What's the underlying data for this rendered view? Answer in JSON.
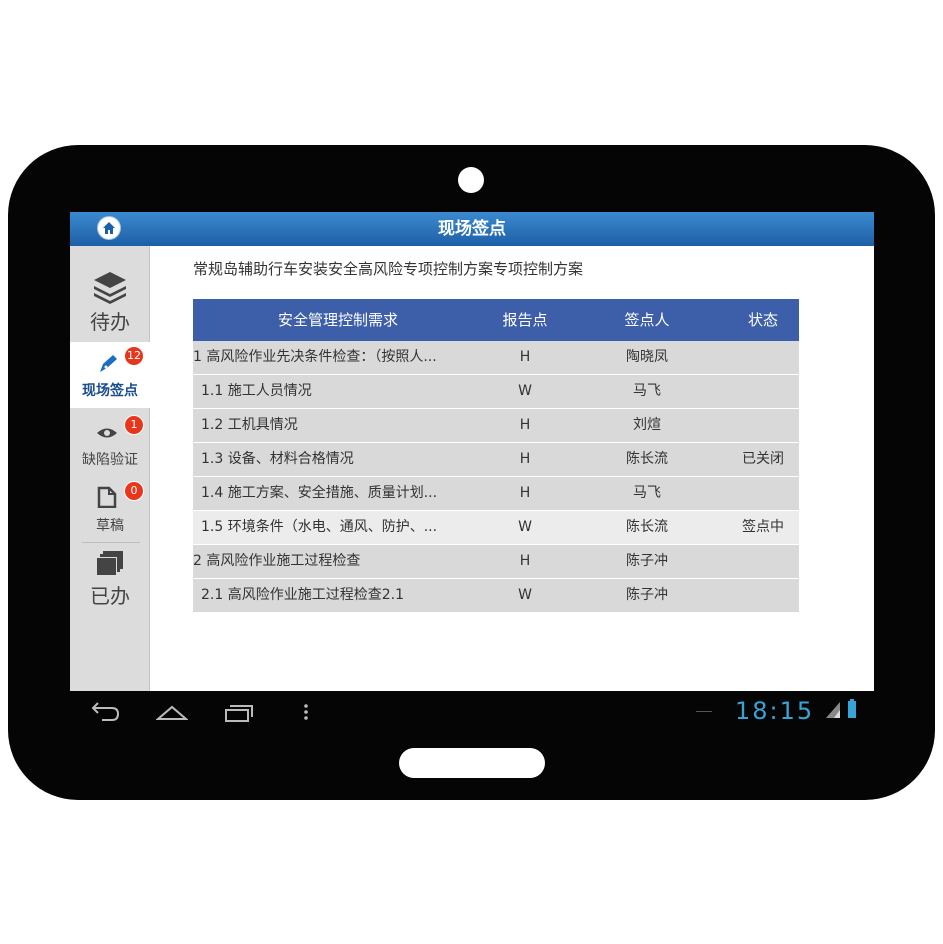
{
  "header": {
    "title": "现场签点"
  },
  "sidebar": {
    "items": [
      {
        "label": "待办",
        "icon": "layers-icon"
      },
      {
        "label": "现场签点",
        "icon": "pen-icon",
        "badge": "12",
        "active": true
      },
      {
        "label": "缺陷验证",
        "icon": "eye-icon",
        "badge": "1"
      },
      {
        "label": "草稿",
        "icon": "document-icon",
        "badge": "0"
      },
      {
        "label": "已办",
        "icon": "stacked-pages-icon"
      }
    ]
  },
  "document": {
    "title": "常规岛辅助行车安装安全高风险专项控制方案专项控制方案"
  },
  "table": {
    "headers": [
      "安全管理控制需求",
      "报告点",
      "签点人",
      "状态"
    ],
    "rows": [
      [
        "1 高风险作业先决条件检查：（按照人...",
        "H",
        "陶晓凤",
        ""
      ],
      [
        "1.1 施工人员情况",
        "W",
        "马飞",
        ""
      ],
      [
        "1.2 工机具情况",
        "H",
        "刘煊",
        ""
      ],
      [
        "1.3 设备、材料合格情况",
        "H",
        "陈长流",
        "已关闭"
      ],
      [
        "1.4 施工方案、安全措施、质量计划...",
        "H",
        "马飞",
        ""
      ],
      [
        "1.5 环境条件（水电、通风、防护、...",
        "W",
        "陈长流",
        "签点中"
      ],
      [
        "2 高风险作业施工过程检查",
        "H",
        "陈子冲",
        ""
      ],
      [
        "2.1 高风险作业施工过程检查2.1",
        "W",
        "陈子冲",
        ""
      ]
    ],
    "selected_row": 5
  },
  "system_bar": {
    "clock": "18:15"
  },
  "colors": {
    "header": "#1d5fa6",
    "table_header": "#3d5ea8",
    "badge": "#e8361d",
    "clock": "#3aa3d6"
  }
}
